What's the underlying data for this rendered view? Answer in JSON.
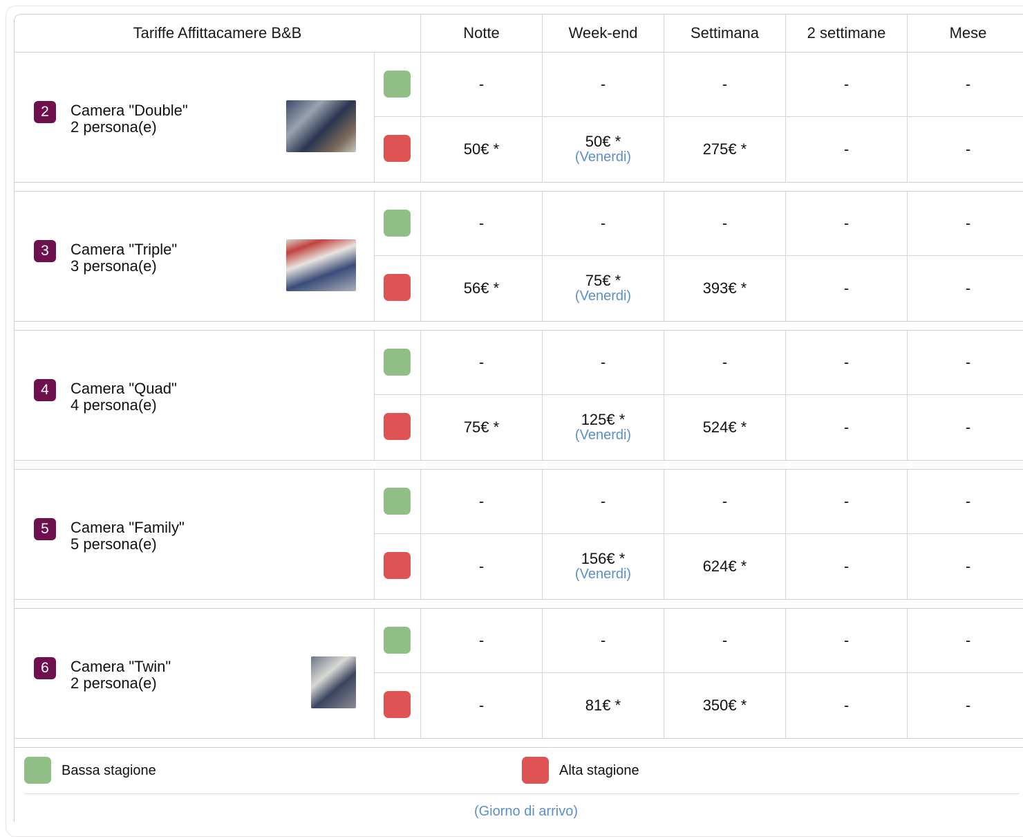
{
  "header": {
    "title": "Tariffe Affittacamere B&B",
    "columns": [
      "Notte",
      "Week-end",
      "Settimana",
      "2 settimane",
      "Mese"
    ]
  },
  "colors": {
    "low_season": "#8fbf86",
    "high_season": "#e05354",
    "badge": "#6e0f4e",
    "link": "#5a8fc9"
  },
  "rooms": [
    {
      "number": "2",
      "name": "Camera \"Double\"",
      "capacity": "2 persona(e)",
      "has_photo": true,
      "low": [
        "-",
        "-",
        "-",
        "-",
        "-"
      ],
      "high": [
        "50€ *",
        "50€ *",
        "275€ *",
        "-",
        "-"
      ],
      "weekend_note": "(Venerdi)"
    },
    {
      "number": "3",
      "name": "Camera \"Triple\"",
      "capacity": "3 persona(e)",
      "has_photo": true,
      "low": [
        "-",
        "-",
        "-",
        "-",
        "-"
      ],
      "high": [
        "56€ *",
        "75€ *",
        "393€ *",
        "-",
        "-"
      ],
      "weekend_note": "(Venerdi)"
    },
    {
      "number": "4",
      "name": "Camera \"Quad\"",
      "capacity": "4 persona(e)",
      "has_photo": false,
      "low": [
        "-",
        "-",
        "-",
        "-",
        "-"
      ],
      "high": [
        "75€ *",
        "125€ *",
        "524€ *",
        "-",
        "-"
      ],
      "weekend_note": "(Venerdi)"
    },
    {
      "number": "5",
      "name": "Camera \"Family\"",
      "capacity": "5 persona(e)",
      "has_photo": false,
      "low": [
        "-",
        "-",
        "-",
        "-",
        "-"
      ],
      "high": [
        "-",
        "156€ *",
        "624€ *",
        "-",
        "-"
      ],
      "weekend_note": "(Venerdi)"
    },
    {
      "number": "6",
      "name": "Camera \"Twin\"",
      "capacity": "2 persona(e)",
      "has_photo": true,
      "low": [
        "-",
        "-",
        "-",
        "-",
        "-"
      ],
      "high": [
        "-",
        "81€ *",
        "350€ *",
        "-",
        "-"
      ],
      "weekend_note": ""
    }
  ],
  "legend": {
    "low_label": "Bassa stagione",
    "high_label": "Alta stagione"
  },
  "footer": {
    "note": "(Giorno di arrivo)"
  }
}
